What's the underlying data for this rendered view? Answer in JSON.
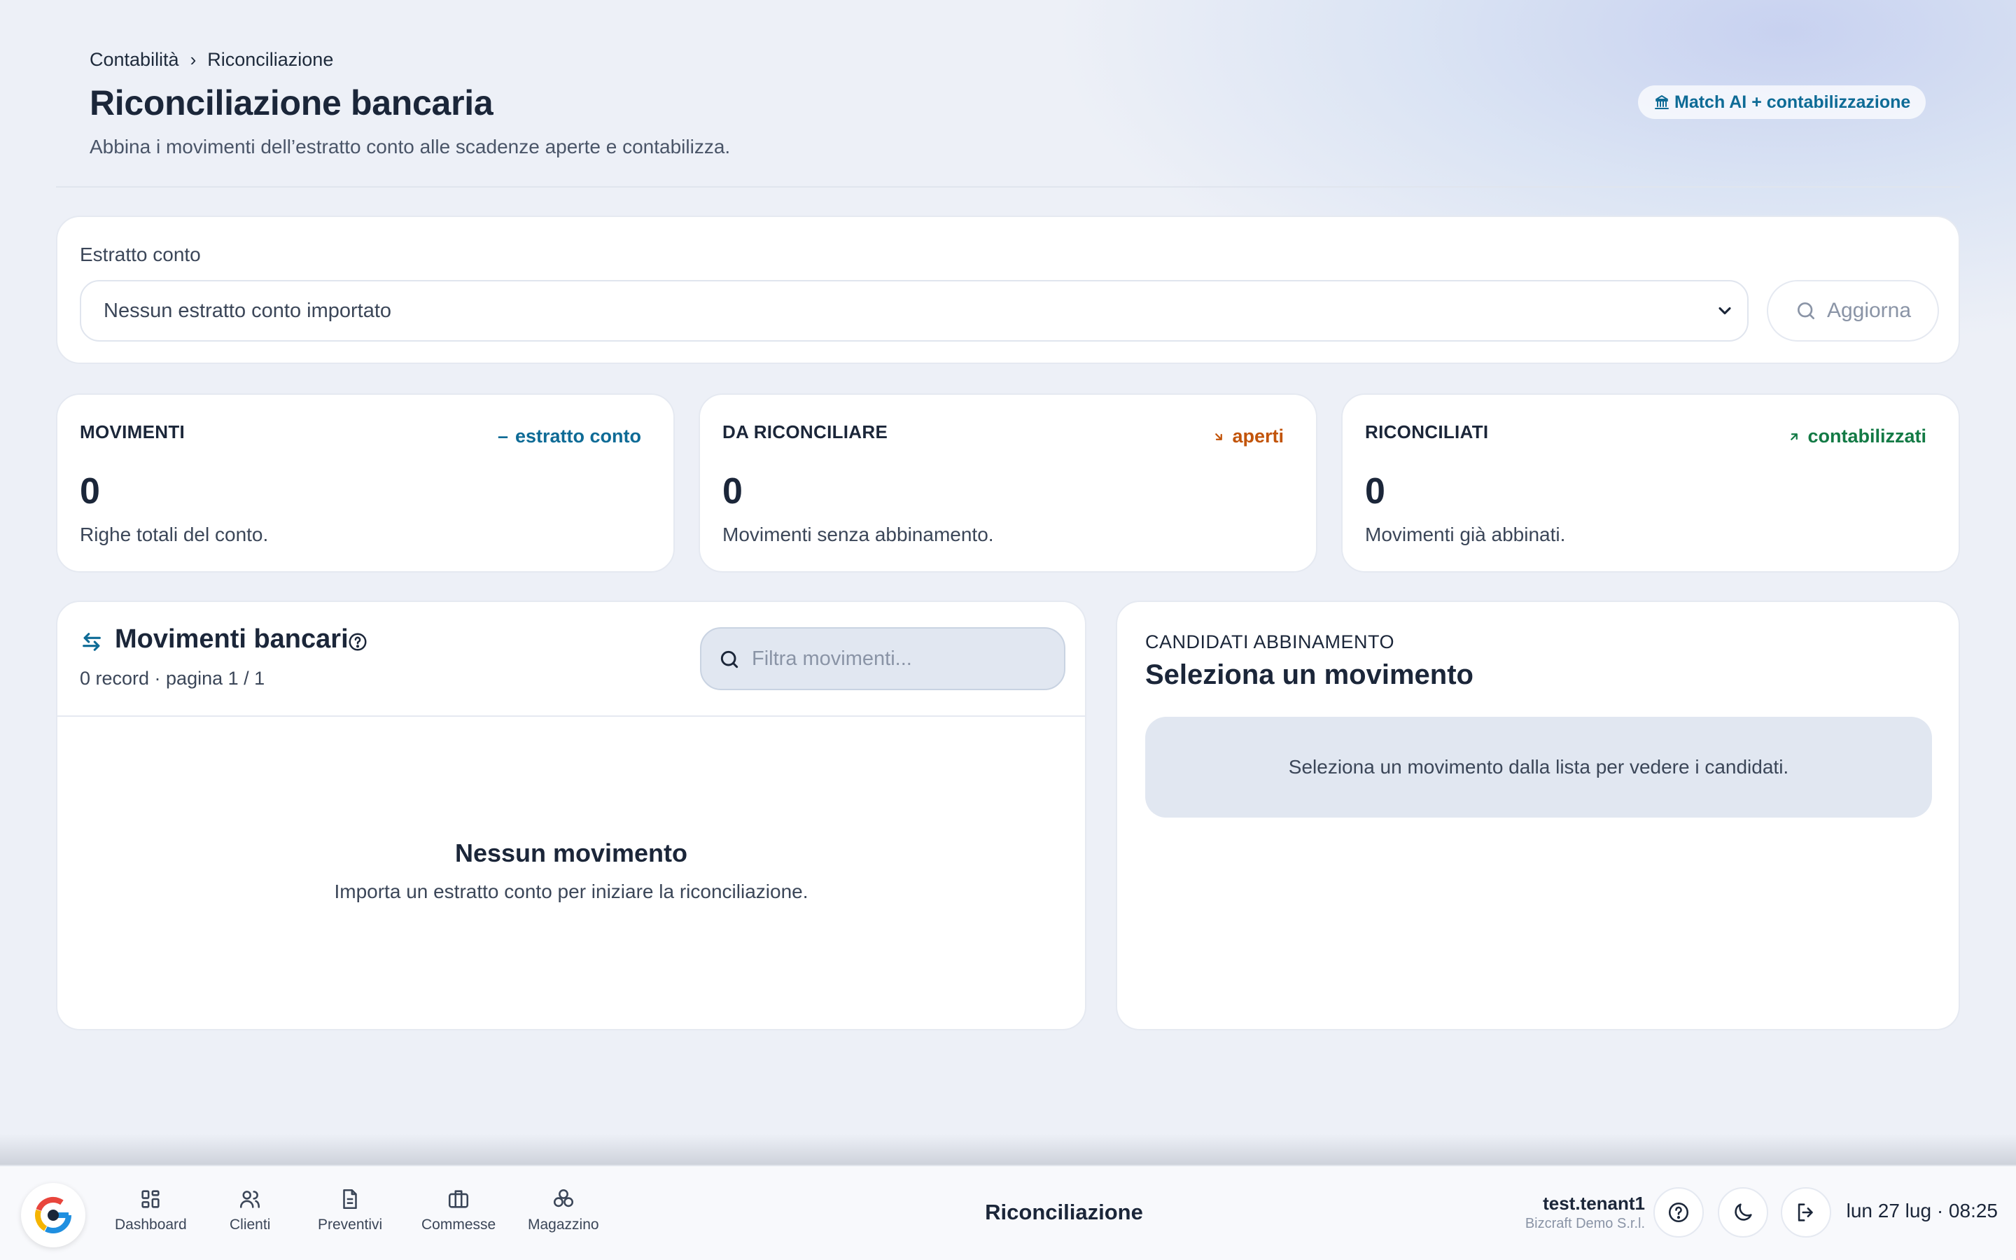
{
  "breadcrumb": {
    "root": "Contabilità",
    "current": "Riconciliazione"
  },
  "header": {
    "title": "Riconciliazione bancaria",
    "subtitle": "Abbina i movimenti dell’estratto conto alle scadenze aperte e contabilizza.",
    "ai_button": "Match AI + contabilizzazione",
    "ai_icon": "bank-icon"
  },
  "estratto": {
    "label": "Estratto conto",
    "selected": "Nessun estratto conto importato",
    "refresh_label": "Aggiorna"
  },
  "stats": [
    {
      "title": "MOVIMENTI",
      "tag": "estratto conto",
      "tag_icon": "dash-icon",
      "tag_color": "#0e6b96",
      "value": "0",
      "desc": "Righe totali del conto."
    },
    {
      "title": "DA RICONCILIARE",
      "tag": "aperti",
      "tag_icon": "arrow-down-right-icon",
      "tag_color": "#c2540a",
      "value": "0",
      "desc": "Movimenti senza abbinamento."
    },
    {
      "title": "RICONCILIATI",
      "tag": "contabilizzati",
      "tag_icon": "arrow-up-right-icon",
      "tag_color": "#137a45",
      "value": "0",
      "desc": "Movimenti già abbinati."
    }
  ],
  "movimenti": {
    "title": "Movimenti bancari",
    "subtitle": "0 record · pagina 1 / 1",
    "filter_placeholder": "Filtra movimenti...",
    "empty_title": "Nessun movimento",
    "empty_sub": "Importa un estratto conto per iniziare la riconciliazione."
  },
  "candidati": {
    "label": "CANDIDATI ABBINAMENTO",
    "title": "Seleziona un movimento",
    "hint": "Seleziona un movimento dalla lista per vedere i candidati."
  },
  "bottombar": {
    "nav": [
      {
        "label": "Dashboard",
        "icon": "grid-icon"
      },
      {
        "label": "Clienti",
        "icon": "users-icon"
      },
      {
        "label": "Preventivi",
        "icon": "document-icon"
      },
      {
        "label": "Commesse",
        "icon": "briefcase-icon"
      },
      {
        "label": "Magazzino",
        "icon": "boxes-icon"
      }
    ],
    "title": "Riconciliazione",
    "user": "test.tenant1",
    "company": "Bizcraft Demo S.r.l.",
    "datetime": "lun 27 lug · 08:25"
  },
  "colors": {
    "accent": "#0e6b96",
    "orange": "#c2540a",
    "green": "#137a45",
    "background": "#edf0f7"
  }
}
